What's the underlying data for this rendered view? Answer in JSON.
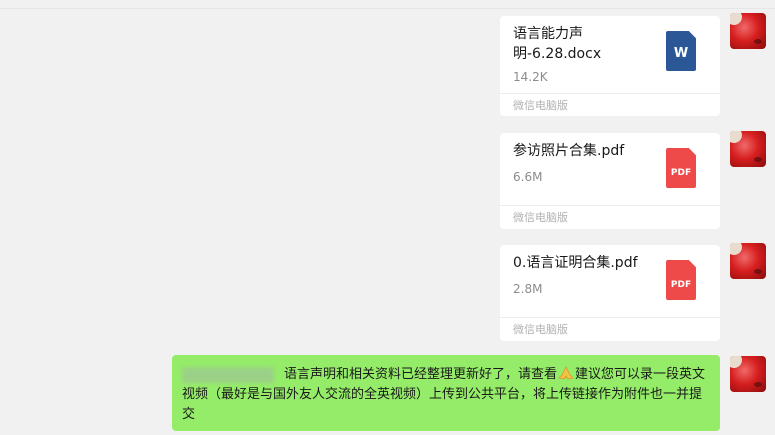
{
  "chat": {
    "messages": [
      {
        "type": "file",
        "name": "语言能力声明-6.28.docx",
        "size": "14.2K",
        "source": "微信电脑版",
        "icon": "word-doc-icon",
        "icon_label": "W",
        "icon_color": "#2b5797"
      },
      {
        "type": "file",
        "name": "参访照片合集.pdf",
        "size": "6.6M",
        "source": "微信电脑版",
        "icon": "pdf-icon",
        "icon_label": "PDF",
        "icon_color": "#ef4a4a"
      },
      {
        "type": "file",
        "name": "0.语言证明合集.pdf",
        "size": "2.8M",
        "source": "微信电脑版",
        "icon": "pdf-icon",
        "icon_label": "PDF",
        "icon_color": "#ef4a4a"
      },
      {
        "type": "text",
        "text_part1": "语言声明和相关资料已经整理更新好了，请查看",
        "text_part2": "建议您可以录一段英文视频（最好是与国外友人交流的全英视频）上传到公共平台，将上传链接作为附件也一并提交",
        "emoji": "pray-hands-emoji",
        "bubble_color": "#95ec69"
      }
    ]
  },
  "colors": {
    "background": "#f1f1f1",
    "card": "#ffffff",
    "outgoing_bubble": "#95ec69"
  }
}
